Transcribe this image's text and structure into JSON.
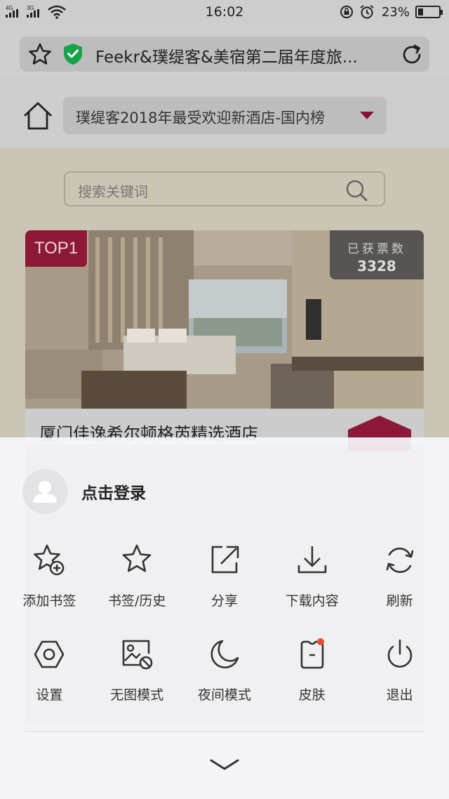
{
  "status_bar": {
    "network_1": "4G",
    "network_2": "3G",
    "time": "16:02",
    "battery": "23%",
    "battery_level_percent": 23,
    "icons": [
      "signal-icon",
      "wifi-icon",
      "lock-rotation-icon",
      "alarm-icon",
      "battery-icon"
    ]
  },
  "browser": {
    "page_title": "Feekr&璞缇客&美宿第二届年度旅...",
    "icons": [
      "star-icon",
      "shield-check-icon",
      "reload-icon"
    ],
    "accent_color": "#16a34a"
  },
  "page": {
    "category_select": "璞缇客2018年最受欢迎新酒店-国内榜",
    "search_placeholder": "搜索关键词",
    "card": {
      "rank": "TOP1",
      "votes_label": "已获票数",
      "votes_count": "3328",
      "hotel_name": "厦门佳逸希尔顿格芮精选酒店"
    },
    "brand_color": "#8d1838"
  },
  "menu": {
    "login_text": "点击登录",
    "items": [
      {
        "label": "添加书签",
        "icon": "star-add-icon"
      },
      {
        "label": "书签/历史",
        "icon": "star-icon"
      },
      {
        "label": "分享",
        "icon": "share-icon"
      },
      {
        "label": "下载内容",
        "icon": "download-icon"
      },
      {
        "label": "刷新",
        "icon": "refresh-icon"
      },
      {
        "label": "设置",
        "icon": "settings-hex-icon"
      },
      {
        "label": "无图模式",
        "icon": "no-image-icon"
      },
      {
        "label": "夜间模式",
        "icon": "moon-icon"
      },
      {
        "label": "皮肤",
        "icon": "skin-shirt-icon"
      },
      {
        "label": "退出",
        "icon": "power-icon"
      }
    ],
    "notification_color": "#f04b2c",
    "collapse_icon": "chevron-down-icon"
  }
}
